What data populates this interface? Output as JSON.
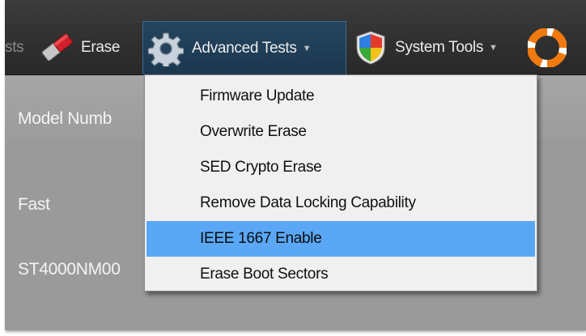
{
  "toolbar": {
    "items": [
      {
        "label": "sts",
        "icon": "test-icon-cutoff"
      },
      {
        "label": "Erase",
        "icon": "eraser-icon"
      },
      {
        "label": "Advanced Tests",
        "icon": "gear-icon"
      },
      {
        "label": "System Tools",
        "icon": "shield-icon"
      },
      {
        "label": "",
        "icon": "lifebuoy-icon"
      }
    ]
  },
  "content": {
    "header": "Model Numb",
    "row1": "Fast",
    "row2": "ST4000NM00"
  },
  "menu": {
    "items": [
      {
        "label": "Firmware Update",
        "highlighted": false
      },
      {
        "label": "Overwrite Erase",
        "highlighted": false
      },
      {
        "label": "SED Crypto Erase",
        "highlighted": false
      },
      {
        "label": "Remove Data Locking Capability",
        "highlighted": false
      },
      {
        "label": "IEEE 1667 Enable",
        "highlighted": true
      },
      {
        "label": "Erase Boot Sectors",
        "highlighted": false
      }
    ]
  },
  "colors": {
    "toolbar_bg": "#2f2f2f",
    "active_menu_bg": "#1c3850",
    "menu_bg": "#f0f0f0",
    "highlight": "#5aa8f5",
    "content_bg": "#9a9a9a"
  }
}
